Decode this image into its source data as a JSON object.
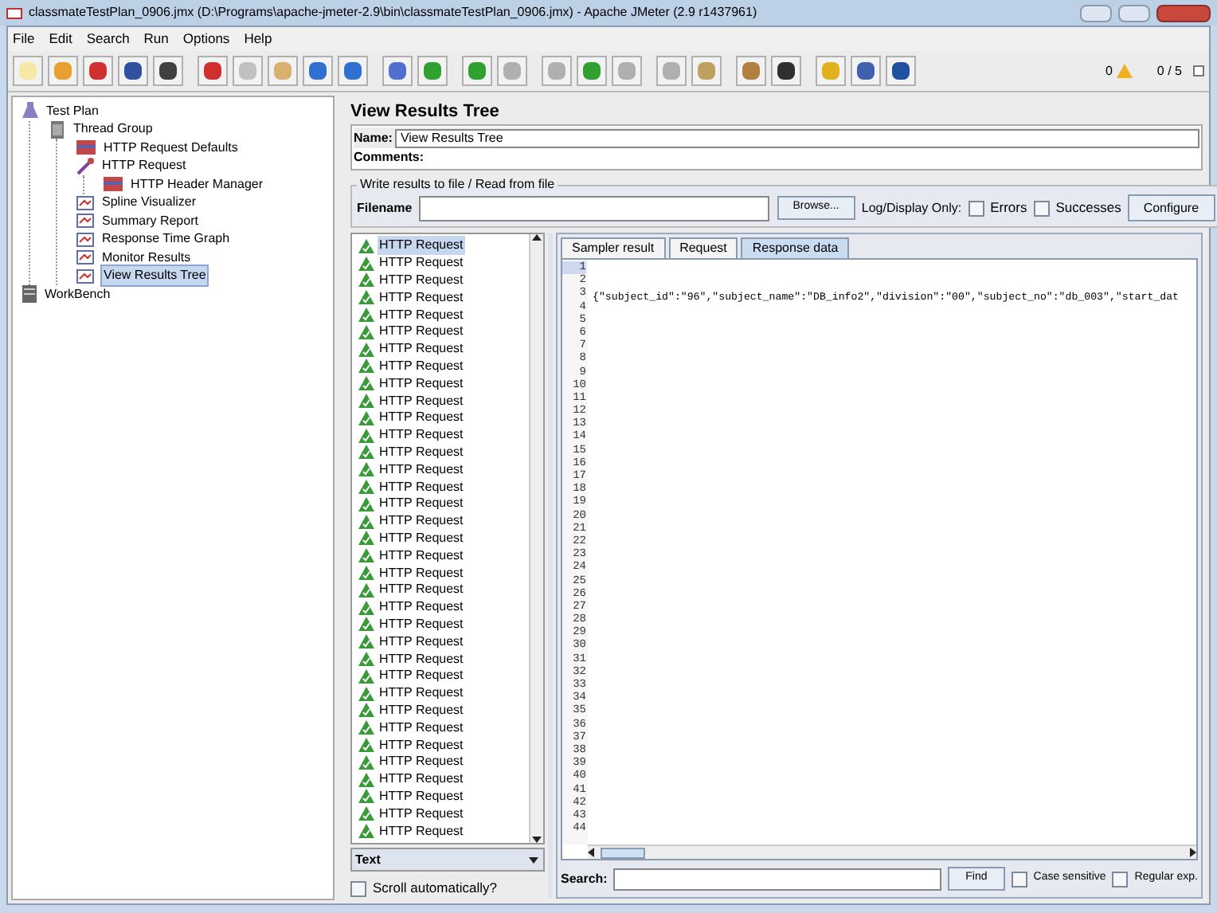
{
  "window": {
    "title": "classmateTestPlan_0906.jmx (D:\\Programs\\apache-jmeter-2.9\\bin\\classmateTestPlan_0906.jmx) - Apache JMeter (2.9 r1437961)"
  },
  "menu": [
    "File",
    "Edit",
    "Search",
    "Run",
    "Options",
    "Help"
  ],
  "toolbar_status": {
    "warnings": "0",
    "threads": "0 / 5"
  },
  "tree": [
    {
      "label": "Test Plan",
      "kind": "plan",
      "selected": false,
      "children": [
        {
          "label": "Thread Group",
          "kind": "group",
          "selected": false,
          "children": [
            {
              "label": "HTTP Request Defaults",
              "kind": "config",
              "selected": false
            },
            {
              "label": "HTTP Request",
              "kind": "sampler",
              "selected": false,
              "children": [
                {
                  "label": "HTTP Header Manager",
                  "kind": "config",
                  "selected": false
                }
              ]
            },
            {
              "label": "Spline Visualizer",
              "kind": "listener",
              "selected": false
            },
            {
              "label": "Summary Report",
              "kind": "listener",
              "selected": false
            },
            {
              "label": "Response Time Graph",
              "kind": "listener",
              "selected": false
            },
            {
              "label": "Monitor Results",
              "kind": "listener",
              "selected": false
            },
            {
              "label": "View Results Tree",
              "kind": "listener",
              "selected": true
            }
          ]
        }
      ]
    },
    {
      "label": "WorkBench",
      "kind": "workbench",
      "selected": false
    }
  ],
  "panel": {
    "title": "View Results Tree",
    "name_label": "Name:",
    "name_value": "View Results Tree",
    "comments_label": "Comments:",
    "file_group": {
      "legend": "Write results to file / Read from file",
      "filename_label": "Filename",
      "browse": "Browse...",
      "log_label": "Log/Display Only:",
      "errors": {
        "label": "Errors",
        "checked": false
      },
      "successes": {
        "label": "Successes",
        "checked": false
      },
      "configure": "Configure"
    }
  },
  "results": [
    {
      "label": "HTTP Request",
      "selected": true
    },
    {
      "label": "HTTP Request",
      "selected": false
    },
    {
      "label": "HTTP Request",
      "selected": false
    },
    {
      "label": "HTTP Request",
      "selected": false
    },
    {
      "label": "HTTP Request",
      "selected": false
    },
    {
      "label": "HTTP Request",
      "selected": false
    },
    {
      "label": "HTTP Request",
      "selected": false
    },
    {
      "label": "HTTP Request",
      "selected": false
    },
    {
      "label": "HTTP Request",
      "selected": false
    },
    {
      "label": "HTTP Request",
      "selected": false
    },
    {
      "label": "HTTP Request",
      "selected": false
    },
    {
      "label": "HTTP Request",
      "selected": false
    },
    {
      "label": "HTTP Request",
      "selected": false
    },
    {
      "label": "HTTP Request",
      "selected": false
    },
    {
      "label": "HTTP Request",
      "selected": false
    },
    {
      "label": "HTTP Request",
      "selected": false
    },
    {
      "label": "HTTP Request",
      "selected": false
    },
    {
      "label": "HTTP Request",
      "selected": false
    },
    {
      "label": "HTTP Request",
      "selected": false
    },
    {
      "label": "HTTP Request",
      "selected": false
    },
    {
      "label": "HTTP Request",
      "selected": false
    },
    {
      "label": "HTTP Request",
      "selected": false
    },
    {
      "label": "HTTP Request",
      "selected": false
    },
    {
      "label": "HTTP Request",
      "selected": false
    },
    {
      "label": "HTTP Request",
      "selected": false
    },
    {
      "label": "HTTP Request",
      "selected": false
    },
    {
      "label": "HTTP Request",
      "selected": false
    },
    {
      "label": "HTTP Request",
      "selected": false
    },
    {
      "label": "HTTP Request",
      "selected": false
    },
    {
      "label": "HTTP Request",
      "selected": false
    },
    {
      "label": "HTTP Request",
      "selected": false
    },
    {
      "label": "HTTP Request",
      "selected": false
    },
    {
      "label": "HTTP Request",
      "selected": false
    },
    {
      "label": "HTTP Request",
      "selected": false
    },
    {
      "label": "HTTP Request",
      "selected": false
    }
  ],
  "renderer": "Text",
  "scroll_auto": {
    "label": "Scroll automatically?",
    "checked": false
  },
  "tabs": [
    {
      "label": "Sampler result",
      "selected": false
    },
    {
      "label": "Request",
      "selected": false
    },
    {
      "label": "Response data",
      "selected": true
    }
  ],
  "response_text": "{\"subject_id\":\"96\",\"subject_name\":\"DB_info2\",\"division\":\"00\",\"subject_no\":\"db_003\",\"start_dat",
  "line_numbers": [
    "1",
    "2",
    "3",
    "4",
    "5",
    "6",
    "7",
    "8",
    "9",
    "10",
    "11",
    "12",
    "13",
    "14",
    "15",
    "16",
    "17",
    "18",
    "19",
    "20",
    "21",
    "22",
    "23",
    "24",
    "25",
    "26",
    "27",
    "28",
    "29",
    "30",
    "31",
    "32",
    "33",
    "34",
    "35",
    "36",
    "37",
    "38",
    "39",
    "40",
    "41",
    "42",
    "43",
    "44"
  ],
  "search": {
    "label": "Search:",
    "find": "Find",
    "case_sensitive": {
      "label": "Case sensitive",
      "checked": false
    },
    "regex": {
      "label": "Regular exp.",
      "checked": false
    }
  }
}
